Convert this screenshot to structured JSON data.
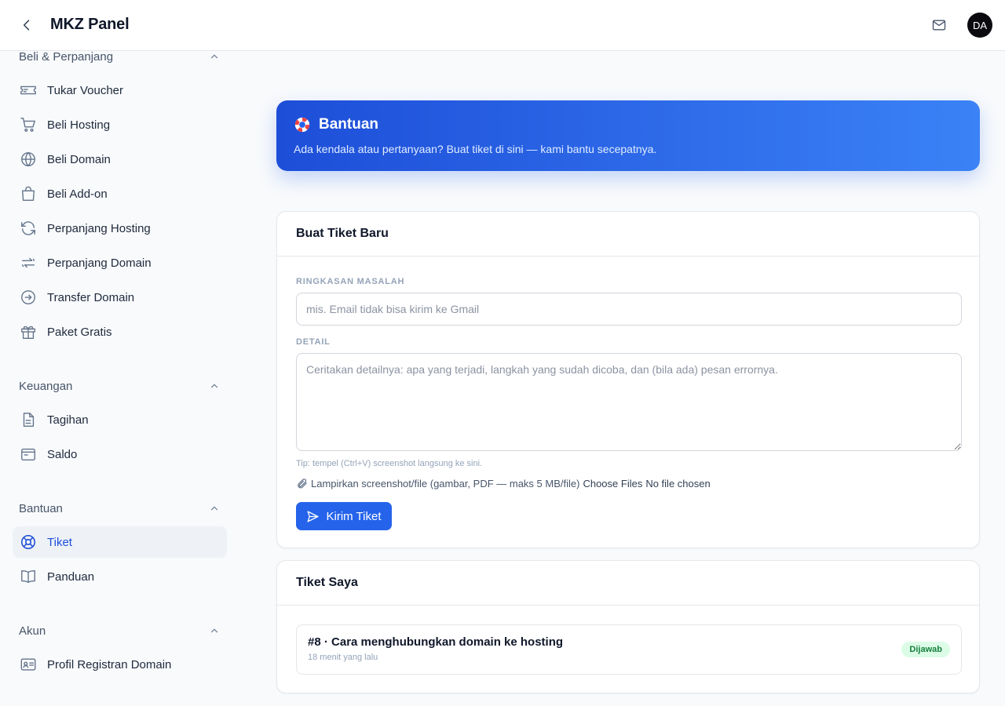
{
  "header": {
    "title": "MKZ Panel",
    "avatar_initials": "DA"
  },
  "sidebar": {
    "sections": [
      {
        "title": "Beli & Perpanjang",
        "items": [
          {
            "label": "Tukar Voucher",
            "icon": "ticket-icon"
          },
          {
            "label": "Beli Hosting",
            "icon": "cart-icon"
          },
          {
            "label": "Beli Domain",
            "icon": "globe-icon"
          },
          {
            "label": "Beli Add-on",
            "icon": "bag-icon"
          },
          {
            "label": "Perpanjang Hosting",
            "icon": "refresh-icon"
          },
          {
            "label": "Perpanjang Domain",
            "icon": "renew-icon"
          },
          {
            "label": "Transfer Domain",
            "icon": "arrow-circle-icon"
          },
          {
            "label": "Paket Gratis",
            "icon": "gift-icon"
          }
        ]
      },
      {
        "title": "Keuangan",
        "items": [
          {
            "label": "Tagihan",
            "icon": "invoice-icon"
          },
          {
            "label": "Saldo",
            "icon": "wallet-icon"
          }
        ]
      },
      {
        "title": "Bantuan",
        "items": [
          {
            "label": "Tiket",
            "icon": "lifebuoy-icon",
            "active": true
          },
          {
            "label": "Panduan",
            "icon": "book-icon"
          }
        ]
      },
      {
        "title": "Akun",
        "items": [
          {
            "label": "Profil Registran Domain",
            "icon": "id-card-icon"
          }
        ]
      }
    ]
  },
  "banner": {
    "title": "Bantuan",
    "subtitle": "Ada kendala atau pertanyaan? Buat tiket di sini — kami bantu secepatnya."
  },
  "new_ticket": {
    "title": "Buat Tiket Baru",
    "summary_label": "RINGKASAN MASALAH",
    "summary_placeholder": "mis. Email tidak bisa kirim ke Gmail",
    "summary_value": "",
    "detail_label": "DETAIL",
    "detail_placeholder": "Ceritakan detailnya: apa yang terjadi, langkah yang sudah dicoba, dan (bila ada) pesan errornya.",
    "tip": "Tip: tempel (Ctrl+V) screenshot langsung ke sini.",
    "attach_label": "Lampirkan screenshot/file (gambar, PDF — maks 5 MB/file)",
    "choose_files": "Choose Files",
    "no_file": "No file chosen",
    "submit_label": "Kirim Tiket"
  },
  "my_tickets": {
    "title": "Tiket Saya",
    "items": [
      {
        "title": "#8 · Cara menghubungkan domain ke hosting",
        "time": "18 menit yang lalu",
        "status": "Dijawab"
      }
    ]
  },
  "colors": {
    "accent": "#2563eb",
    "active_text": "#1d4ed8",
    "badge_bg": "#dcfce7",
    "badge_text": "#15803d"
  }
}
